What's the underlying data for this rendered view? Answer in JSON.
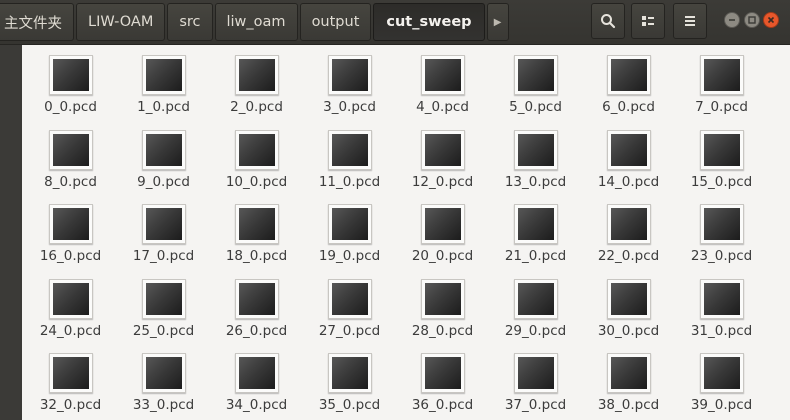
{
  "pathbar": {
    "crumbs": [
      "主文件夹",
      "LIW-OAM",
      "src",
      "liw_oam",
      "output"
    ],
    "active": "cut_sweep",
    "overflow_icon": "triangle-right-icon"
  },
  "toolbar": {
    "search_icon": "search-icon",
    "view_icon": "list-view-icon",
    "menu_icon": "hamburger-menu-icon"
  },
  "window_controls": [
    "minimize-icon",
    "maximize-icon",
    "close-icon"
  ],
  "colors": {
    "header": "#3c3b37",
    "content_bg": "#f5f4f2",
    "close_button": "#e7572b"
  },
  "files": [
    {
      "name": "0_0.pcd"
    },
    {
      "name": "1_0.pcd"
    },
    {
      "name": "2_0.pcd"
    },
    {
      "name": "3_0.pcd"
    },
    {
      "name": "4_0.pcd"
    },
    {
      "name": "5_0.pcd"
    },
    {
      "name": "6_0.pcd"
    },
    {
      "name": "7_0.pcd"
    },
    {
      "name": "8_0.pcd"
    },
    {
      "name": "9_0.pcd"
    },
    {
      "name": "10_0.pcd"
    },
    {
      "name": "11_0.pcd"
    },
    {
      "name": "12_0.pcd"
    },
    {
      "name": "13_0.pcd"
    },
    {
      "name": "14_0.pcd"
    },
    {
      "name": "15_0.pcd"
    },
    {
      "name": "16_0.pcd"
    },
    {
      "name": "17_0.pcd"
    },
    {
      "name": "18_0.pcd"
    },
    {
      "name": "19_0.pcd"
    },
    {
      "name": "20_0.pcd"
    },
    {
      "name": "21_0.pcd"
    },
    {
      "name": "22_0.pcd"
    },
    {
      "name": "23_0.pcd"
    },
    {
      "name": "24_0.pcd"
    },
    {
      "name": "25_0.pcd"
    },
    {
      "name": "26_0.pcd"
    },
    {
      "name": "27_0.pcd"
    },
    {
      "name": "28_0.pcd"
    },
    {
      "name": "29_0.pcd"
    },
    {
      "name": "30_0.pcd"
    },
    {
      "name": "31_0.pcd"
    },
    {
      "name": "32_0.pcd"
    },
    {
      "name": "33_0.pcd"
    },
    {
      "name": "34_0.pcd"
    },
    {
      "name": "35_0.pcd"
    },
    {
      "name": "36_0.pcd"
    },
    {
      "name": "37_0.pcd"
    },
    {
      "name": "38_0.pcd"
    },
    {
      "name": "39_0.pcd"
    }
  ]
}
